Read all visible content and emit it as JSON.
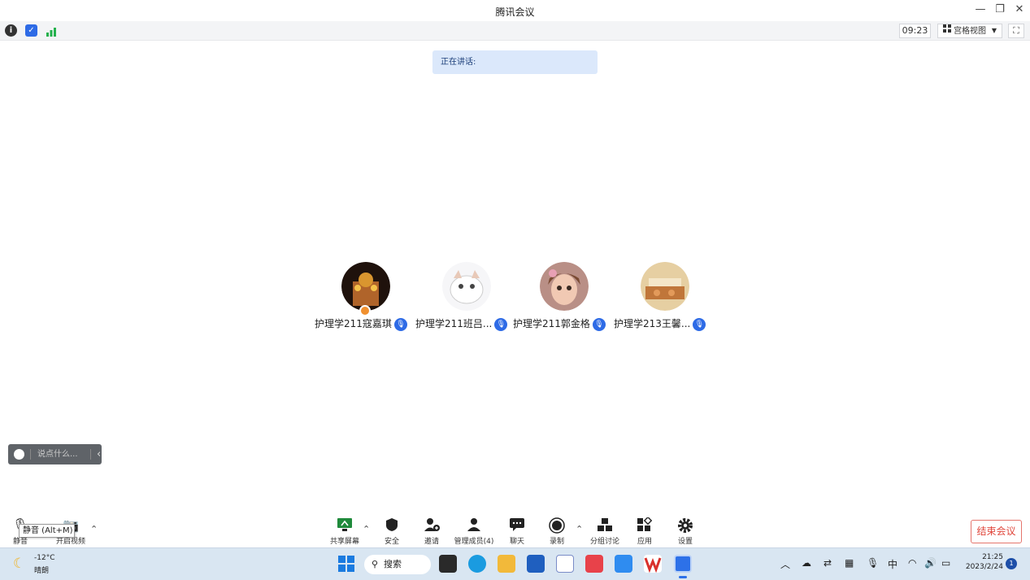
{
  "window": {
    "title": "腾讯会议",
    "minimize_glyph": "—",
    "restore_glyph": "❐",
    "close_glyph": "✕"
  },
  "infobar": {
    "time": "09:23",
    "view_label": "宫格视图",
    "icons": [
      "info-icon",
      "shield-icon",
      "signal-icon"
    ]
  },
  "speaking": {
    "label": "正在讲话:"
  },
  "participants": [
    {
      "name": "护理学211寇嘉琪",
      "host": true,
      "avatar_color": "#6b3a1e"
    },
    {
      "name": "护理学211班吕...",
      "host": false,
      "avatar_color": "#e8e8ee"
    },
    {
      "name": "护理学211郭金格",
      "host": false,
      "avatar_color": "#c98f7e"
    },
    {
      "name": "护理学213王馨...",
      "host": false,
      "avatar_color": "#d6b07a"
    }
  ],
  "chat": {
    "placeholder": "说点什么...",
    "collapse_glyph": "‹"
  },
  "toolbar": {
    "mute_label": "静音",
    "video_label": "开启视频",
    "mute_tooltip": "静音 (Alt+M)",
    "tools": [
      {
        "label": "共享屏幕",
        "icon": "share-screen-icon"
      },
      {
        "label": "安全",
        "icon": "security-icon"
      },
      {
        "label": "邀请",
        "icon": "invite-icon"
      },
      {
        "label": "管理成员(4)",
        "icon": "members-icon"
      },
      {
        "label": "聊天",
        "icon": "chat-icon"
      },
      {
        "label": "录制",
        "icon": "record-icon"
      },
      {
        "label": "分组讨论",
        "icon": "breakout-icon"
      },
      {
        "label": "应用",
        "icon": "apps-icon"
      },
      {
        "label": "设置",
        "icon": "settings-icon"
      }
    ],
    "end_label": "结束会议"
  },
  "taskbar": {
    "weather_temp": "-12°C",
    "weather_desc": "晴朗",
    "search_label": "搜索",
    "ime": "中",
    "time": "21:25",
    "date": "2023/2/24",
    "notification_count": "1"
  },
  "colors": {
    "accent": "#2e6be6",
    "end_red": "#e0463b",
    "speaking_bg": "#dbe8fb"
  }
}
